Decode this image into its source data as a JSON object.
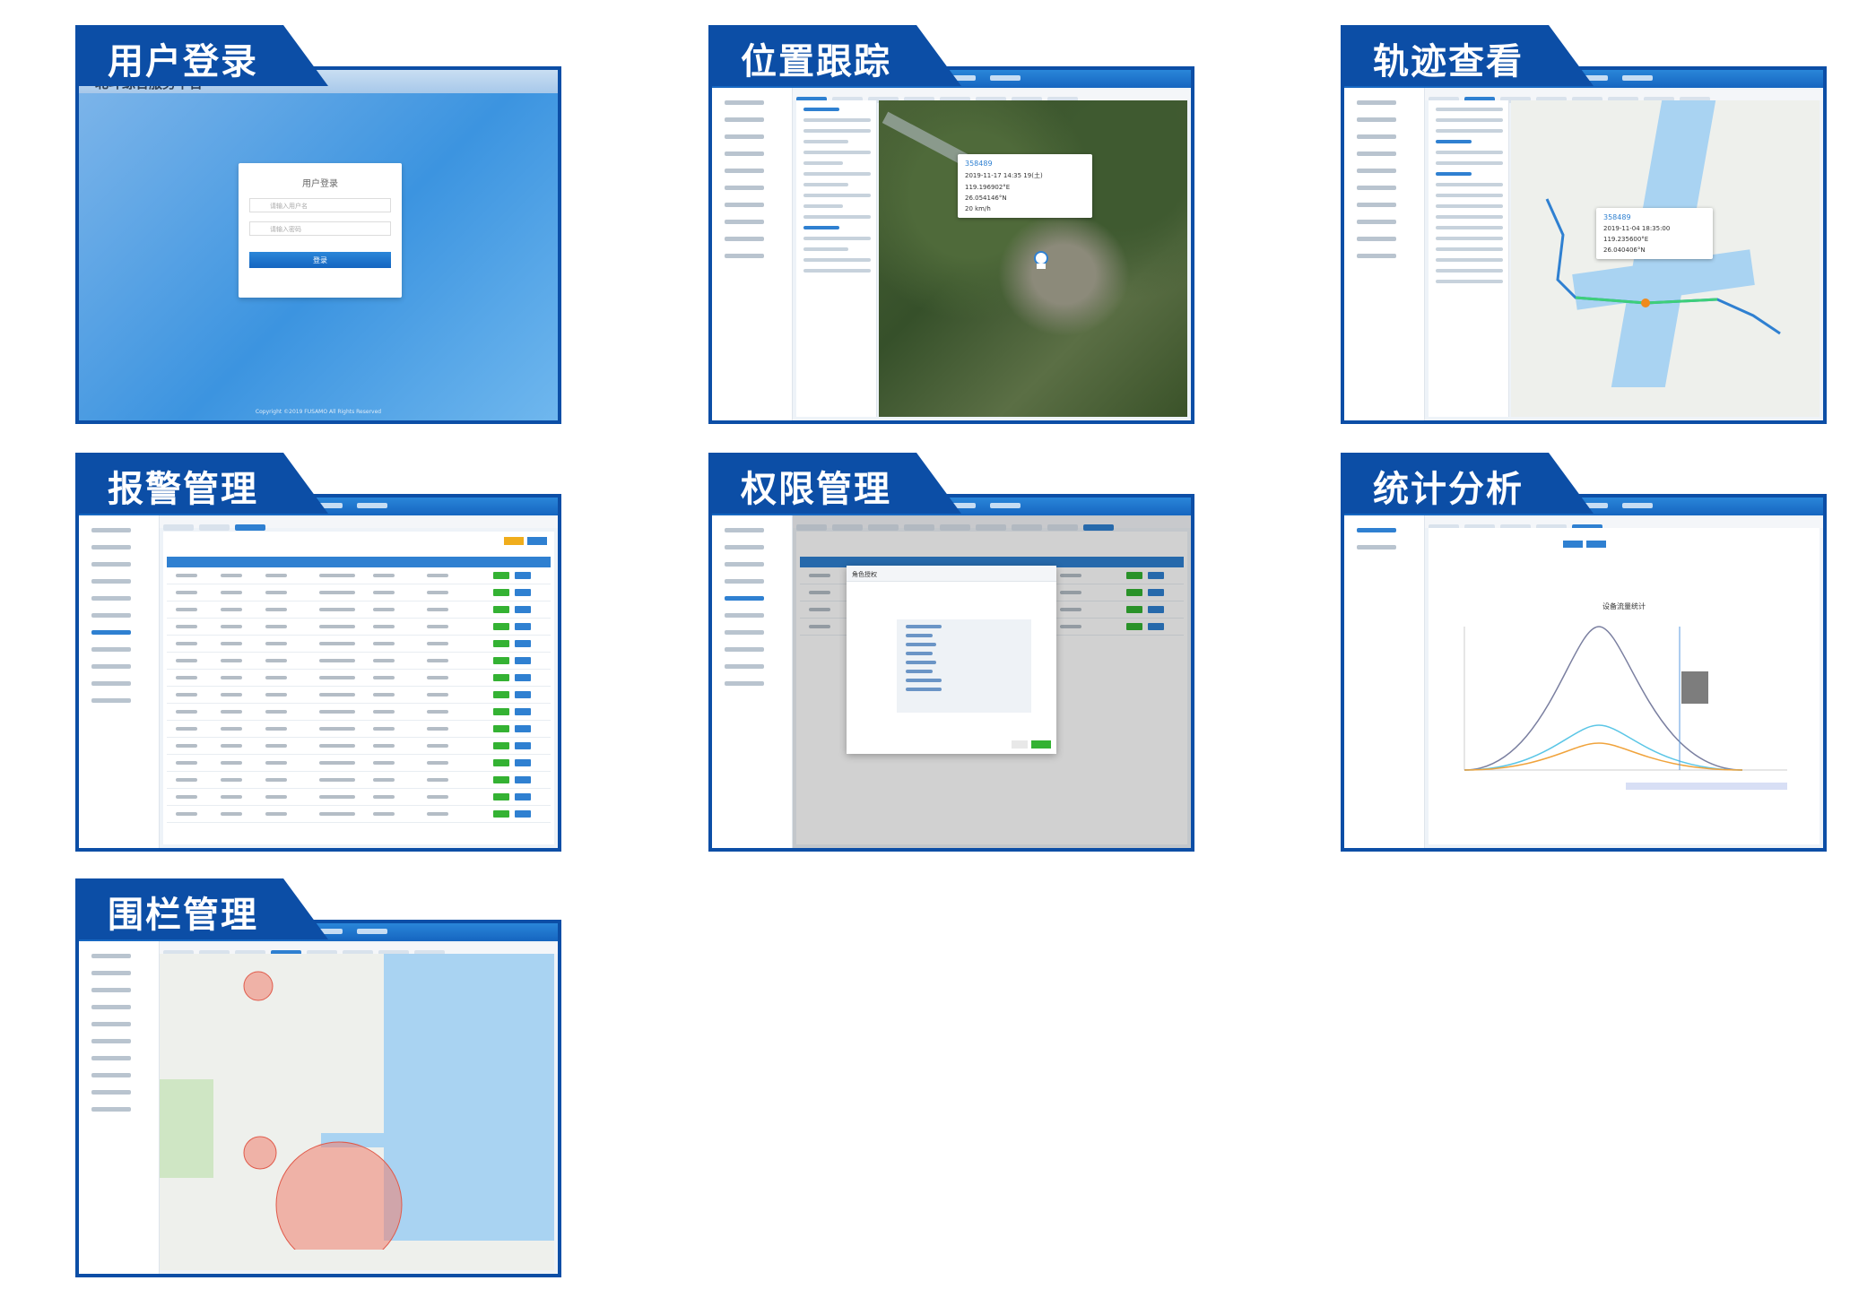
{
  "panels": [
    {
      "id": "login",
      "title": "用户登录"
    },
    {
      "id": "tracking",
      "title": "位置跟踪"
    },
    {
      "id": "trajectory",
      "title": "轨迹查看"
    },
    {
      "id": "alarm",
      "title": "报警管理"
    },
    {
      "id": "permission",
      "title": "权限管理"
    },
    {
      "id": "statistics",
      "title": "统计分析"
    },
    {
      "id": "fence",
      "title": "围栏管理"
    }
  ],
  "app": {
    "name": "北斗综合服务平台",
    "login_heading": "用户登录",
    "login_user_placeholder": "请输入用户名",
    "login_pass_placeholder": "请输入密码",
    "login_button": "登录",
    "copyright": "Copyright ©2019 FUSAMO All Rights Reserved",
    "tracking_popup_id": "358489",
    "tracking_time": "2019-11-17 14:35 19(土)",
    "tracking_lng": "119.196902°E",
    "tracking_lat": "26.054146°N",
    "tracking_speed": "20 km/h",
    "trajectory_popup_id": "358489",
    "trajectory_time": "2019-11-04 18:35:00",
    "trajectory_lng": "119.235600°E",
    "trajectory_lat": "26.040406°N",
    "permission_modal_title": "角色授权",
    "statistics_chart_title": "设备流量统计"
  },
  "colors": {
    "brand": "#0c4ea6",
    "primary": "#2f80d1",
    "success": "#34b233",
    "danger": "#e03a3a"
  }
}
